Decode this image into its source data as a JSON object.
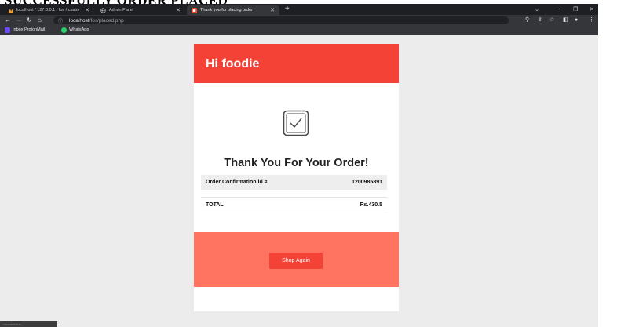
{
  "page_heading": "SUCCESSFULLY ORDER PLACED",
  "browser": {
    "tabs": [
      {
        "label": "localhost / 127.0.0.1 / fos / custo",
        "icon": "phpmyadmin-icon"
      },
      {
        "label": "Admin Panel",
        "icon": "globe-icon"
      },
      {
        "label": "Thank you for placing order",
        "icon": "site-icon"
      }
    ],
    "new_tab": "+",
    "url_host": "localhost",
    "url_path": "/fos/placed.php",
    "bookmarks": [
      {
        "label": "Inbox ProtonMail",
        "icon": "protonmail-icon",
        "color": "#6d4aff"
      },
      {
        "label": "WhatsApp",
        "icon": "whatsapp-icon",
        "color": "#25d366"
      }
    ]
  },
  "card": {
    "greeting": "Hi foodie",
    "thank_you": "Thank You For Your Order!",
    "confirmation_label": "Order Confirmation id #",
    "confirmation_id": "1200985891",
    "total_label": "TOTAL",
    "total_value": "Rs.430.5",
    "shop_again": "Shop Again"
  },
  "colors": {
    "header": "#f44336",
    "footer": "#ff7361",
    "button": "#f44336"
  },
  "bottom_chip": "................"
}
